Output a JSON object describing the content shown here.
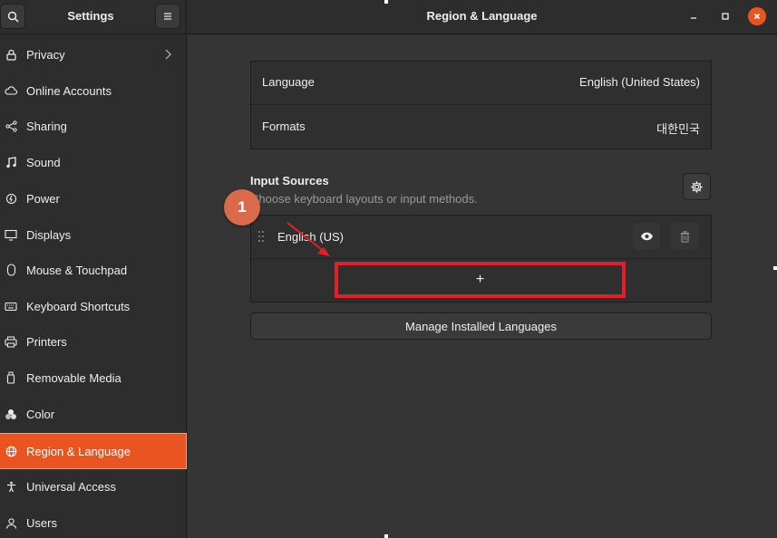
{
  "header": {
    "sidebar_title": "Settings",
    "main_title": "Region & Language",
    "search_icon": "search-icon",
    "menu_icon": "hamburger-menu-icon"
  },
  "sidebar": {
    "items": [
      {
        "label": "Privacy",
        "icon": "lock-icon"
      },
      {
        "label": "Online Accounts",
        "icon": "cloud-icon"
      },
      {
        "label": "Sharing",
        "icon": "share-icon"
      },
      {
        "label": "Sound",
        "icon": "music-note-icon"
      },
      {
        "label": "Power",
        "icon": "power-icon"
      },
      {
        "label": "Displays",
        "icon": "display-icon"
      },
      {
        "label": "Mouse & Touchpad",
        "icon": "mouse-icon"
      },
      {
        "label": "Keyboard Shortcuts",
        "icon": "keyboard-icon"
      },
      {
        "label": "Printers",
        "icon": "printer-icon"
      },
      {
        "label": "Removable Media",
        "icon": "usb-drive-icon"
      },
      {
        "label": "Color",
        "icon": "color-icon"
      },
      {
        "label": "Region & Language",
        "icon": "globe-icon",
        "active": true
      },
      {
        "label": "Universal Access",
        "icon": "accessibility-icon"
      },
      {
        "label": "Users",
        "icon": "user-icon"
      }
    ]
  },
  "region": {
    "language_label": "Language",
    "language_value": "English (United States)",
    "formats_label": "Formats",
    "formats_value": "대한민국"
  },
  "input_sources": {
    "title": "Input Sources",
    "subtitle": "Choose keyboard layouts or input methods.",
    "sources": [
      {
        "label": "English (US)"
      }
    ],
    "add_label": "+"
  },
  "manage_languages_label": "Manage Installed Languages",
  "annotation": {
    "step": "1"
  },
  "colors": {
    "accent": "#e95420",
    "annotation": "#e0202a",
    "badge": "#d96a4a"
  }
}
